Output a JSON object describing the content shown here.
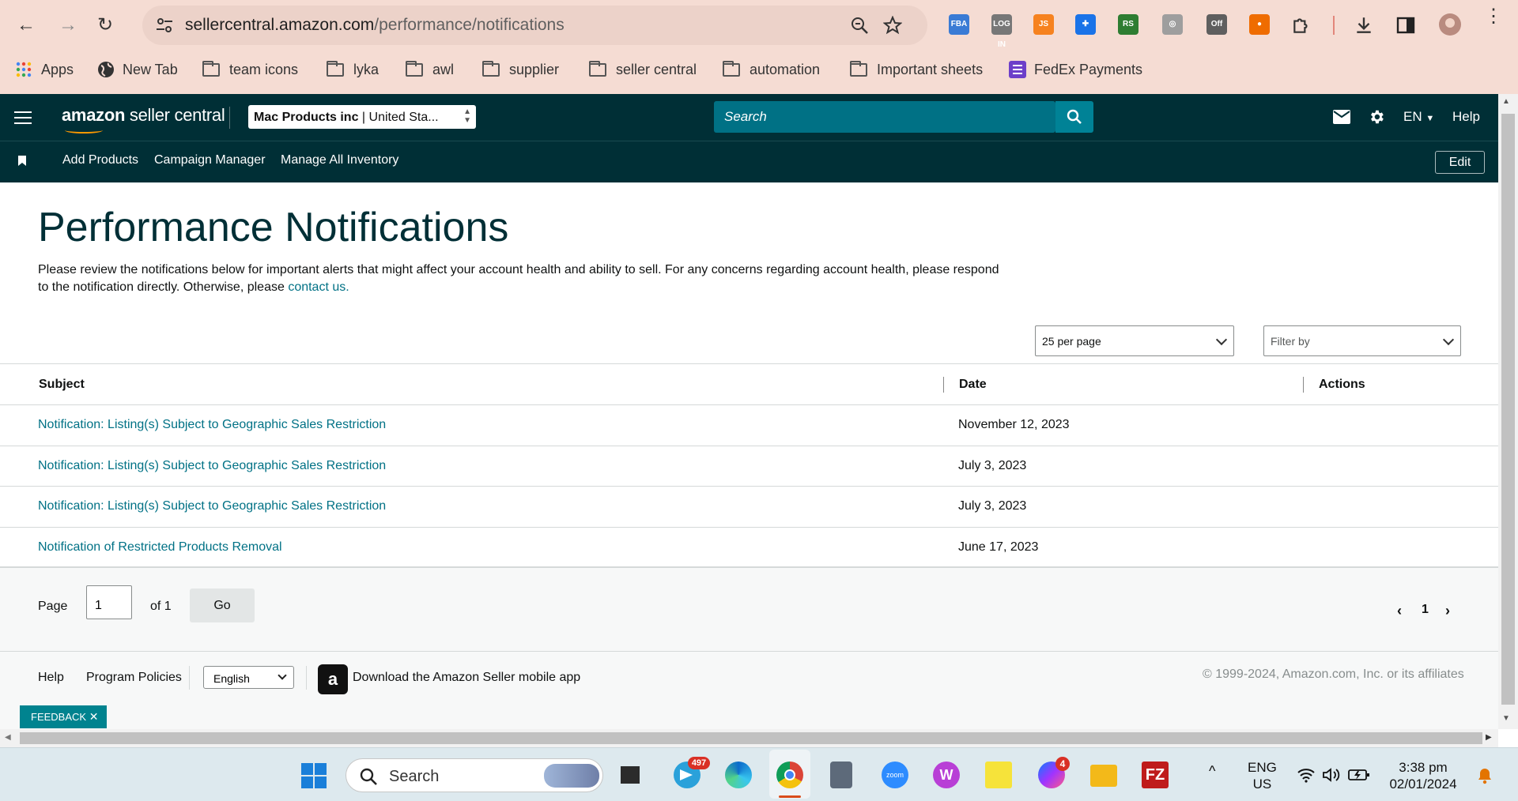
{
  "browser": {
    "url_host": "sellercentral.amazon.com",
    "url_path": "/performance/notifications",
    "bookmarks": [
      "Apps",
      "New Tab",
      "team icons",
      "lyka",
      "awl",
      "supplier",
      "seller central",
      "automation",
      "Important sheets",
      "FedEx Payments"
    ],
    "extensions": [
      {
        "name": "fba-extension-icon",
        "text": "FBA",
        "color": "#3a7bd5"
      },
      {
        "name": "login-extension-icon",
        "text": "LOG IN",
        "color": "#777777"
      },
      {
        "name": "js-extension-icon",
        "text": "JS",
        "color": "#f6821f"
      },
      {
        "name": "blue-cross-extension-icon",
        "text": "✚",
        "color": "#1a73e8"
      },
      {
        "name": "rs-extension-icon",
        "text": "RS",
        "color": "#2e7d32"
      },
      {
        "name": "grey-extension-icon",
        "text": "◎",
        "color": "#9e9e9e"
      },
      {
        "name": "off-extension-icon",
        "text": "Off",
        "color": "#5f5f5f"
      },
      {
        "name": "orange-circle-extension-icon",
        "text": "●",
        "color": "#ef6c00"
      }
    ]
  },
  "header": {
    "logo_bold": "amazon",
    "logo_rest": " seller central",
    "account_name": "Mac Products inc",
    "account_region": " | United Sta...",
    "search_placeholder": "Search",
    "language": "EN",
    "help": "Help"
  },
  "subnav": {
    "links": [
      "Add Products",
      "Campaign Manager",
      "Manage All Inventory"
    ],
    "edit": "Edit"
  },
  "main": {
    "title": "Performance Notifications",
    "description": "Please review the notifications below for important alerts that might affect your account health and ability to sell. For any concerns regarding account health, please respond to the notification directly. Otherwise, please ",
    "contact_link": "contact us.",
    "per_page": "25 per page",
    "filter_placeholder": "Filter by"
  },
  "table": {
    "headers": {
      "subject": "Subject",
      "date": "Date",
      "actions": "Actions"
    },
    "rows": [
      {
        "subject": "Notification: Listing(s) Subject to Geographic Sales Restriction",
        "date": "November 12, 2023"
      },
      {
        "subject": "Notification: Listing(s) Subject to Geographic Sales Restriction",
        "date": "July 3, 2023"
      },
      {
        "subject": "Notification: Listing(s) Subject to Geographic Sales Restriction",
        "date": "July 3, 2023"
      },
      {
        "subject": "Notification of Restricted Products Removal",
        "date": "June 17, 2023"
      }
    ]
  },
  "pagination": {
    "page_label": "Page",
    "page_value": "1",
    "of_label": "of 1",
    "go": "Go",
    "current_page": "1"
  },
  "footer": {
    "help": "Help",
    "program_policies": "Program Policies",
    "language": "English",
    "app_text": "Download the Amazon Seller mobile app",
    "copyright": "© 1999-2024, Amazon.com, Inc. or its affiliates",
    "feedback": "FEEDBACK"
  },
  "taskbar": {
    "search": "Search",
    "telegram_badge": "497",
    "messenger_badge": "4",
    "lang_1": "ENG",
    "lang_2": "US",
    "time": "3:38 pm",
    "date": "02/01/2024"
  }
}
